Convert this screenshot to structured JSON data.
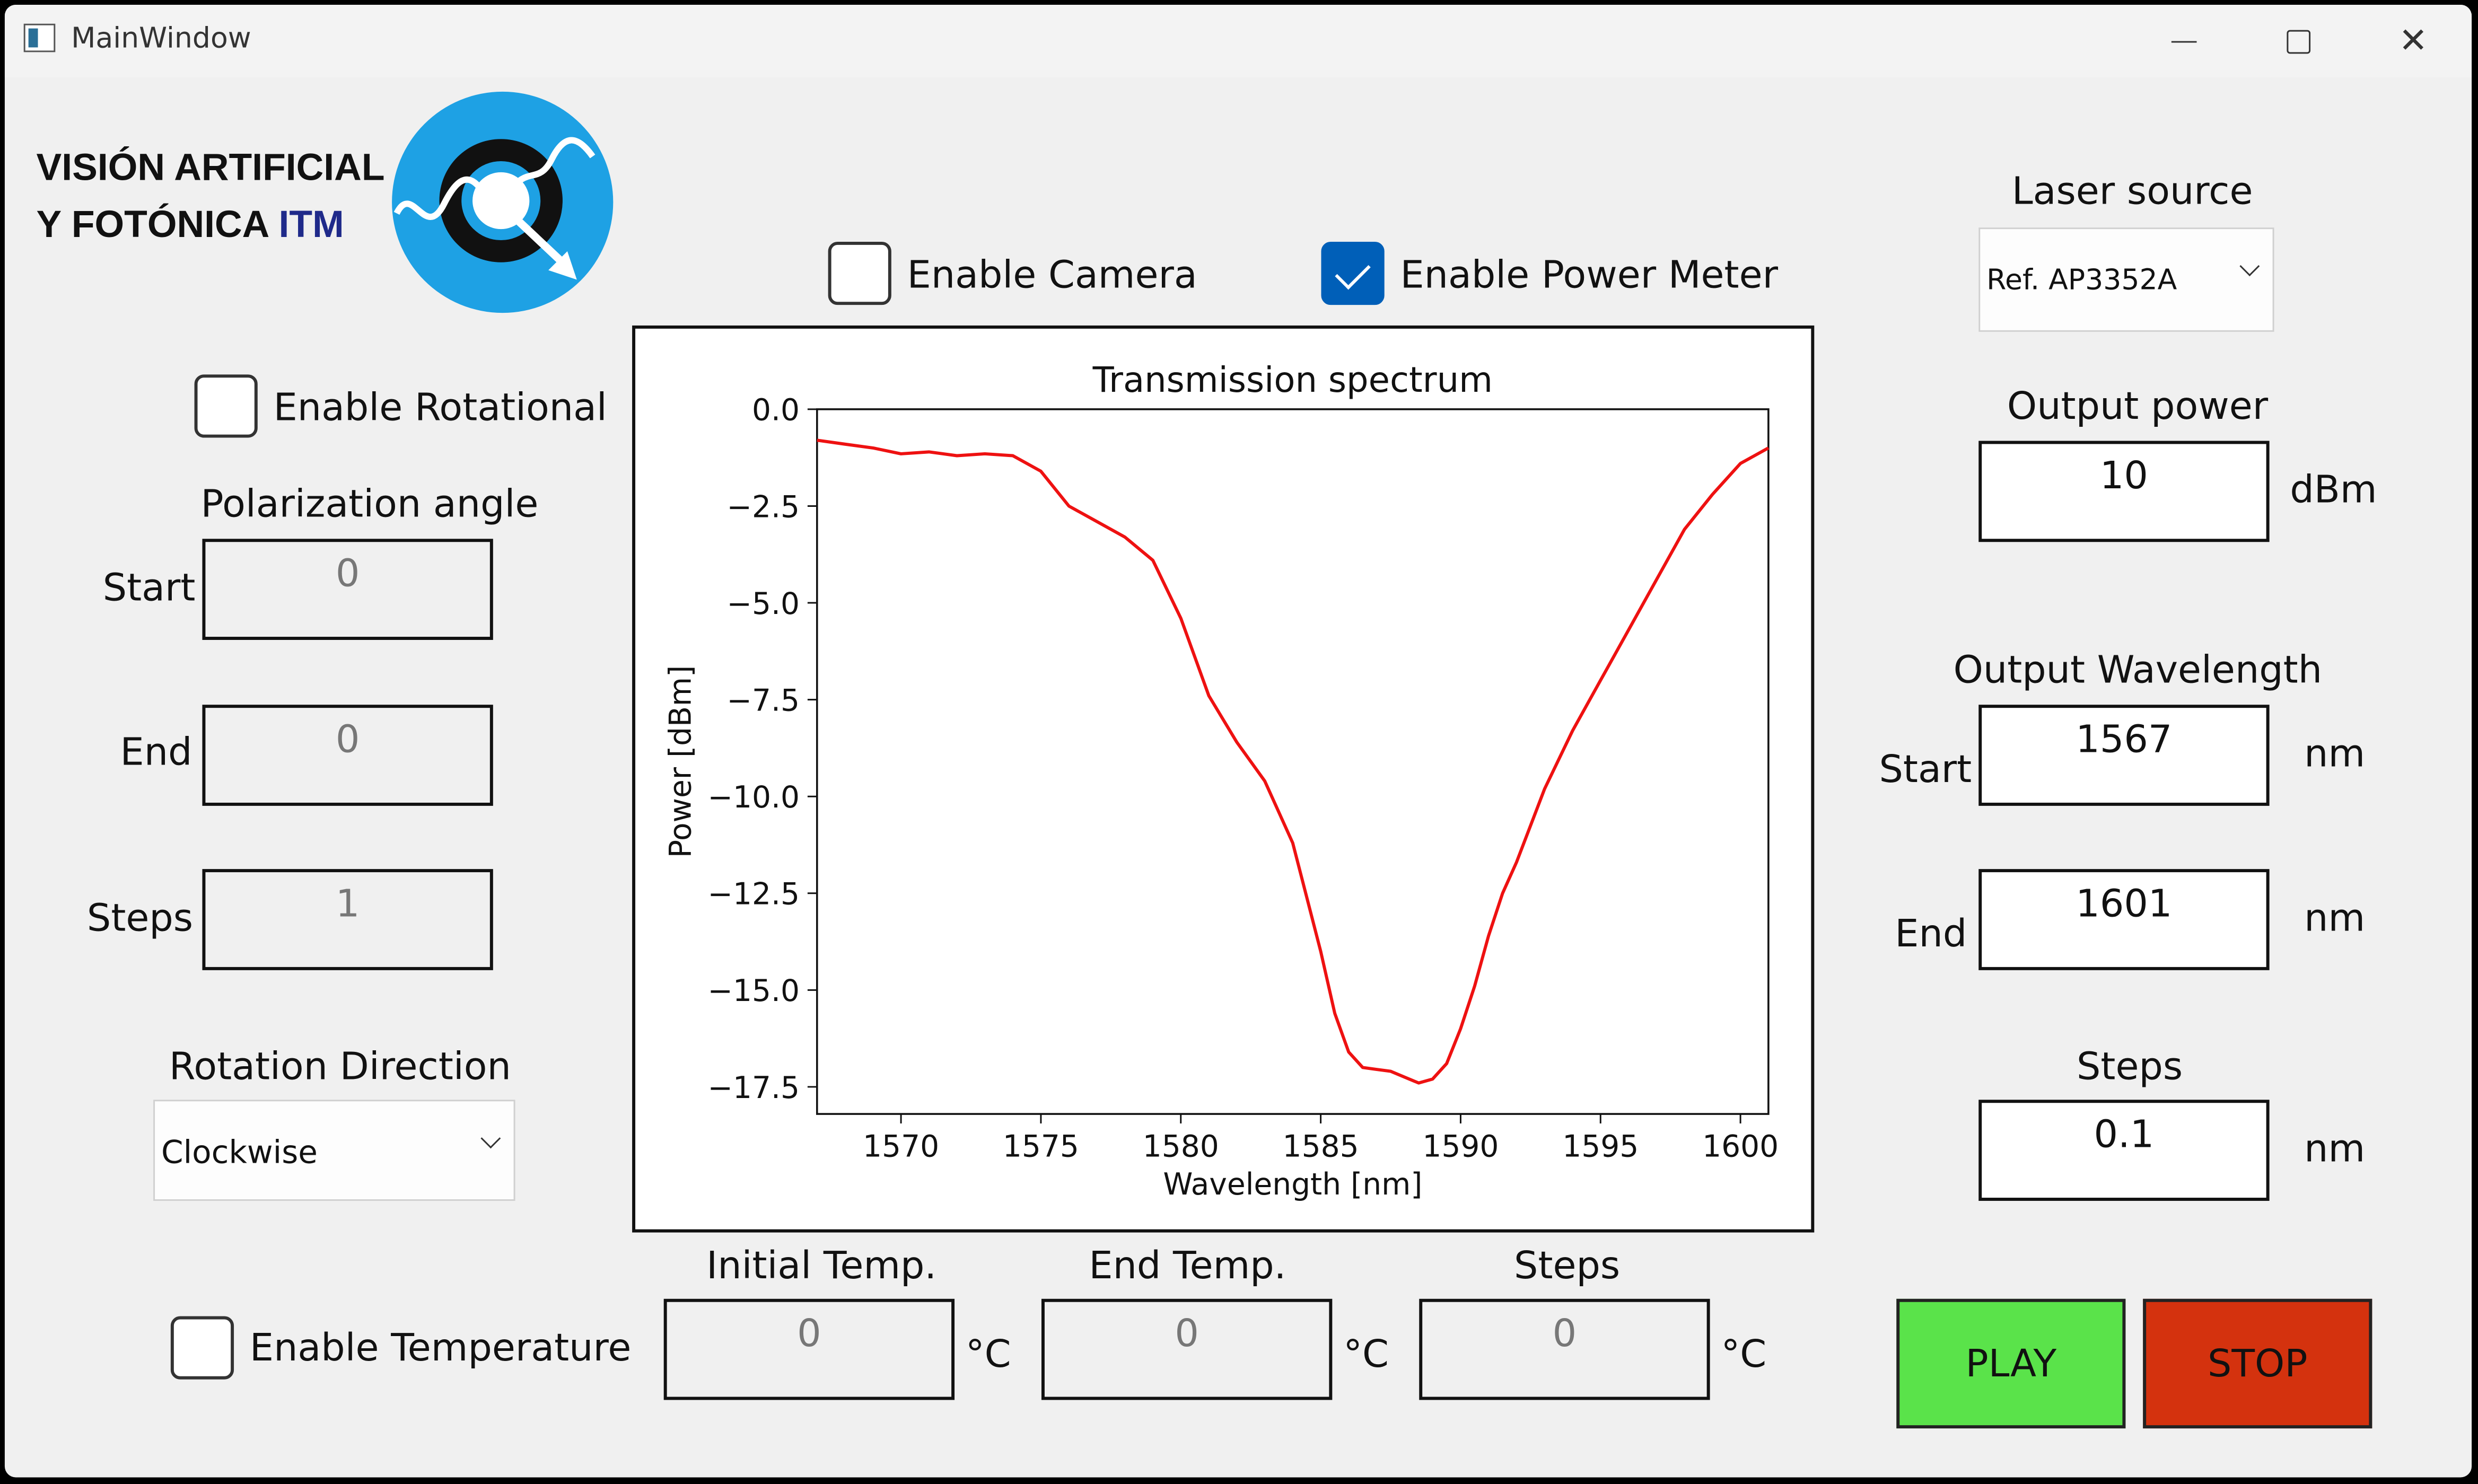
{
  "window": {
    "title": "MainWindow"
  },
  "logo": {
    "line1": "VISIÓN ARTIFICIAL",
    "line2_prefix": "Y FOTÓNICA ",
    "line2_accent": "ITM",
    "accent_color": "#1f2a8a",
    "emblem_color": "#1ea1e4"
  },
  "checks": {
    "camera": {
      "label": "Enable Camera",
      "checked": false
    },
    "power_meter": {
      "label": "Enable Power Meter",
      "checked": true
    },
    "rotational": {
      "label": "Enable Rotational",
      "checked": false
    },
    "temperature": {
      "label": "Enable Temperature",
      "checked": false
    }
  },
  "polarization": {
    "title": "Polarization angle",
    "start": {
      "label": "Start",
      "value": "0"
    },
    "end": {
      "label": "End",
      "value": "0"
    },
    "steps": {
      "label": "Steps",
      "value": "1"
    }
  },
  "rotation": {
    "label": "Rotation Direction",
    "value": "Clockwise"
  },
  "temperature": {
    "initial": {
      "label": "Initial Temp.",
      "value": "0",
      "unit": "°C"
    },
    "end": {
      "label": "End Temp.",
      "value": "0",
      "unit": "°C"
    },
    "steps": {
      "label": "Steps",
      "value": "0",
      "unit": "°C"
    }
  },
  "laser": {
    "label": "Laser source",
    "value": "Ref. AP3352A"
  },
  "output_power": {
    "label": "Output power",
    "value": "10",
    "unit": "dBm"
  },
  "wavelength": {
    "title": "Output Wavelength",
    "start": {
      "label": "Start",
      "value": "1567",
      "unit": "nm"
    },
    "end": {
      "label": "End",
      "value": "1601",
      "unit": "nm"
    },
    "steps": {
      "label": "Steps",
      "value": "0.1",
      "unit": "nm"
    }
  },
  "buttons": {
    "play": {
      "label": "PLAY",
      "color": "#5ae34a"
    },
    "stop": {
      "label": "STOP",
      "color": "#d4320e"
    }
  },
  "chart_data": {
    "type": "line",
    "title": "Transmission spectrum",
    "xlabel": "Wavelength [nm]",
    "ylabel": "Power [dBm]",
    "xlim": [
      1567,
      1601
    ],
    "ylim": [
      -18.2,
      0.0
    ],
    "xticks": [
      1570,
      1575,
      1580,
      1585,
      1590,
      1595,
      1600
    ],
    "yticks": [
      0.0,
      -2.5,
      -5.0,
      -7.5,
      -10.0,
      -12.5,
      -15.0,
      -17.5
    ],
    "ytick_labels": [
      "0.0",
      "−2.5",
      "−5.0",
      "−7.5",
      "−10.0",
      "−12.5",
      "−15.0",
      "−17.5"
    ],
    "grid": false,
    "series": [
      {
        "color": "#ee1111",
        "x": [
          1567,
          1568,
          1569,
          1570,
          1571,
          1572,
          1573,
          1574,
          1575,
          1576,
          1577,
          1578,
          1579,
          1580,
          1581,
          1582,
          1583,
          1584,
          1585,
          1585.5,
          1586,
          1586.5,
          1587,
          1587.5,
          1588,
          1588.5,
          1589,
          1589.5,
          1590,
          1590.5,
          1591,
          1591.5,
          1592,
          1593,
          1594,
          1595,
          1596,
          1597,
          1598,
          1599,
          1600,
          1601
        ],
        "y": [
          -0.8,
          -0.9,
          -1.0,
          -1.15,
          -1.1,
          -1.2,
          -1.15,
          -1.2,
          -1.6,
          -2.5,
          -2.9,
          -3.3,
          -3.9,
          -5.4,
          -7.4,
          -8.6,
          -9.6,
          -11.2,
          -14.0,
          -15.6,
          -16.6,
          -17.0,
          -17.05,
          -17.1,
          -17.25,
          -17.4,
          -17.3,
          -16.9,
          -16.0,
          -14.9,
          -13.6,
          -12.5,
          -11.7,
          -9.8,
          -8.3,
          -7.0,
          -5.7,
          -4.4,
          -3.1,
          -2.2,
          -1.4,
          -1.0
        ]
      }
    ]
  }
}
